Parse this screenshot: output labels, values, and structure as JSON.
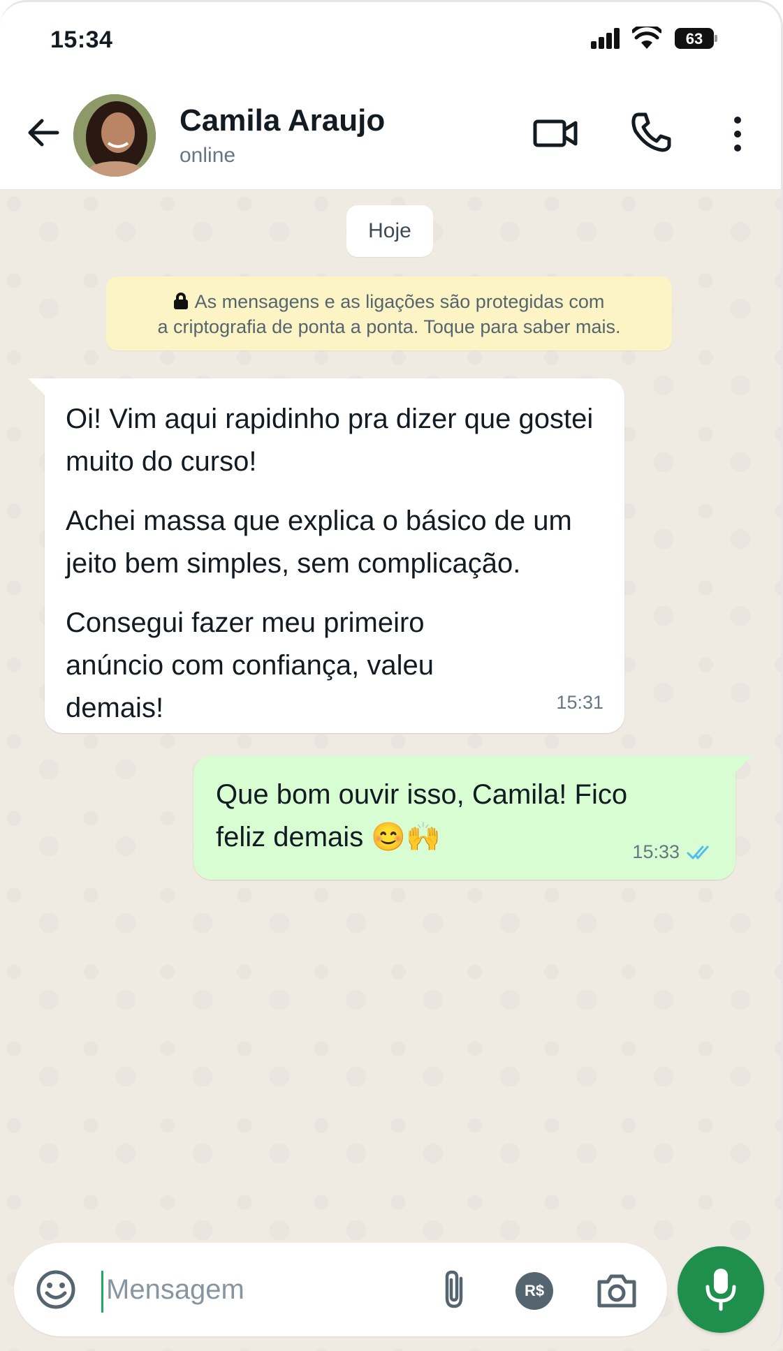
{
  "status_bar": {
    "time": "15:34",
    "battery": "63"
  },
  "header": {
    "contact_name": "Camila Araujo",
    "contact_status": "online"
  },
  "chat": {
    "date_chip": "Hoje",
    "encryption_line1": "As mensagens e as ligações são protegidas com",
    "encryption_line2": "a criptografia de ponta a ponta. Toque para saber mais.",
    "messages": [
      {
        "direction": "incoming",
        "paragraphs": [
          "Oi! Vim aqui rapidinho pra dizer que gostei muito do curso!",
          "Achei massa que explica o básico de um jeito bem simples, sem complicação.",
          "Consegui fazer meu primeiro anúncio com confiança, valeu demais!"
        ],
        "time": "15:31"
      },
      {
        "direction": "outgoing",
        "text": "Que bom ouvir isso, Camila! Fico feliz demais 😊🙌",
        "time": "15:33",
        "status": "read"
      }
    ]
  },
  "input_bar": {
    "placeholder": "Mensagem",
    "payment_label": "R$"
  },
  "colors": {
    "accent": "#1f8f4e",
    "outgoing_bubble": "#d9fdd3",
    "chat_bg": "#efeae2",
    "read_check": "#53bdeb"
  }
}
